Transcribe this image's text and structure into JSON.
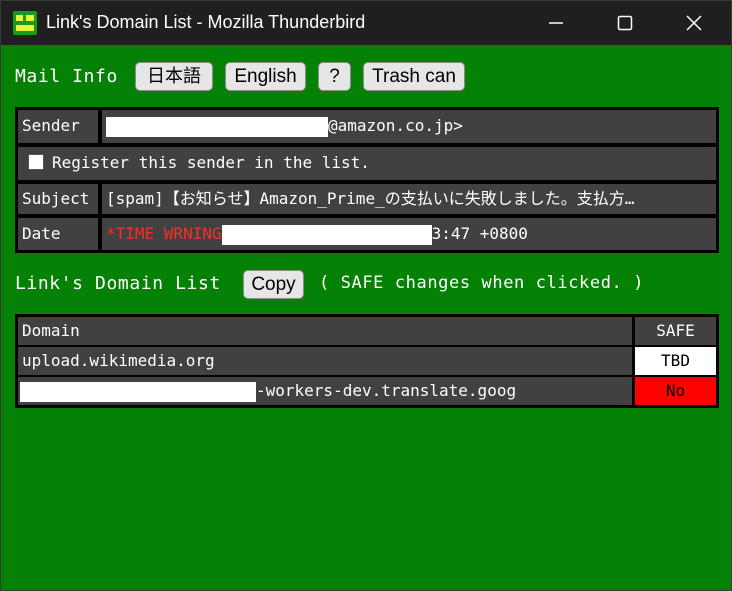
{
  "window": {
    "title": "Link's Domain List - Mozilla Thunderbird"
  },
  "header": {
    "mail_info_label": "Mail Info",
    "lang_japanese_label": "日本語",
    "lang_english_label": "English",
    "help_label": "?",
    "trash_label": "Trash can"
  },
  "mail": {
    "sender_label": "Sender",
    "sender_value": "@amazon.co.jp>",
    "register_label": "Register this sender in the list.",
    "register_checked": false,
    "subject_label": "Subject",
    "subject_value": "[spam]【お知らせ】Amazon_Prime_の支払いに失敗しました。支払方…",
    "date_label": "Date",
    "date_warning": "*TIME WRNING",
    "date_value": "3:47 +0800"
  },
  "links": {
    "section_label": "Link's Domain List",
    "copy_label": "Copy",
    "hint": "( SAFE changes when clicked. )",
    "col_domain": "Domain",
    "col_safe": "SAFE",
    "rows": [
      {
        "domain": "upload.wikimedia.org",
        "safe": "TBD",
        "safe_color": "#ffffff",
        "safe_text_color": "#000000"
      },
      {
        "domain": "-workers-dev.translate.goog",
        "safe": "No",
        "safe_color": "#ff0000",
        "safe_text_color": "#000000"
      }
    ]
  },
  "colors": {
    "window_background": "#058105",
    "cell_background": "#414141",
    "warning": "#ff2a2a"
  }
}
